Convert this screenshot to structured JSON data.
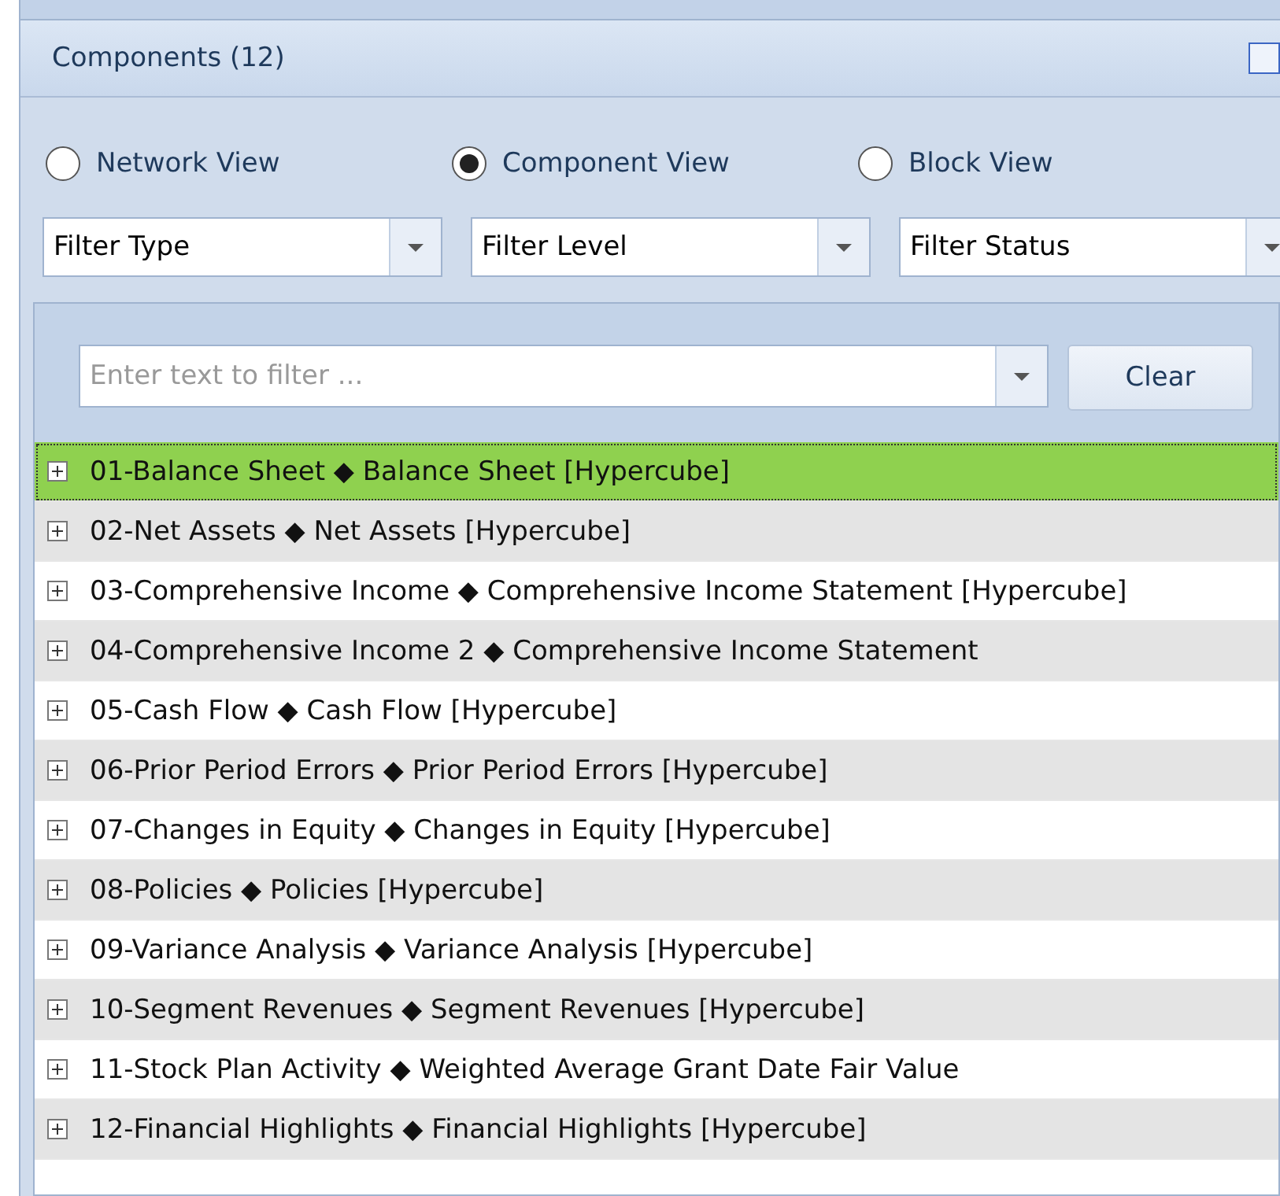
{
  "panel": {
    "title": "Components (12)"
  },
  "views": [
    {
      "label": "Network View",
      "selected": false
    },
    {
      "label": "Component View",
      "selected": true
    },
    {
      "label": "Block View",
      "selected": false
    }
  ],
  "filters": [
    {
      "value": "Filter Type"
    },
    {
      "value": "Filter Level"
    },
    {
      "value": "Filter Status"
    }
  ],
  "search": {
    "placeholder": "Enter text to filter ...",
    "button": "Clear"
  },
  "rows": [
    {
      "text": "01-Balance Sheet ◆ Balance Sheet [Hypercube]",
      "selected": true,
      "expanded": false
    },
    {
      "text": "02-Net Assets ◆ Net Assets [Hypercube]",
      "selected": false,
      "expanded": false
    },
    {
      "text": "03-Comprehensive Income ◆ Comprehensive Income Statement [Hypercube]",
      "selected": false,
      "expanded": false
    },
    {
      "text": "04-Comprehensive Income 2 ◆ Comprehensive Income Statement",
      "selected": false,
      "expanded": false
    },
    {
      "text": "05-Cash Flow ◆ Cash Flow [Hypercube]",
      "selected": false,
      "expanded": false
    },
    {
      "text": "06-Prior Period Errors ◆ Prior Period Errors [Hypercube]",
      "selected": false,
      "expanded": false
    },
    {
      "text": "07-Changes in Equity ◆ Changes in Equity [Hypercube]",
      "selected": false,
      "expanded": false
    },
    {
      "text": "08-Policies ◆ Policies [Hypercube]",
      "selected": false,
      "expanded": false
    },
    {
      "text": "09-Variance Analysis ◆ Variance Analysis [Hypercube]",
      "selected": false,
      "expanded": false
    },
    {
      "text": "10-Segment Revenues ◆ Segment Revenues [Hypercube]",
      "selected": false,
      "expanded": false
    },
    {
      "text": "11-Stock Plan Activity ◆ Weighted Average Grant Date Fair Value",
      "selected": false,
      "expanded": false
    },
    {
      "text": "12-Financial Highlights ◆ Financial Highlights [Hypercube]",
      "selected": false,
      "expanded": false
    }
  ]
}
